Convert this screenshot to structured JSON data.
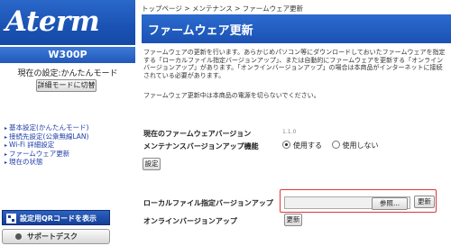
{
  "sidebar": {
    "logo": "Aterm",
    "model": "W300P",
    "mode_text": "現在の設定:かんたんモード",
    "mode_button": "詳細モードに切替",
    "nav_items": [
      {
        "label": "基本設定(かんたんモード)"
      },
      {
        "label": "接続先設定(公衆無線LAN)"
      },
      {
        "label": "Wi-Fi 詳細設定"
      },
      {
        "label": "ファームウェア更新"
      },
      {
        "label": "現在の状態"
      }
    ],
    "qr_button": "設定用QRコードを表示",
    "support_button": "サポートデスク"
  },
  "breadcrumb": "トップページ > メンテナンス > ファームウェア更新",
  "page_title": "ファームウェア更新",
  "description": "ファームウェアの更新を行います。あらかじめパソコン等にダウンロードしておいたファームウェアを指定する「ローカルファイル指定バージョンアップ」、または自動的にファームウェアを更新する「オンラインバージョンアップ」があります。「オンラインバージョンアップ」の場合は本商品がインターネットに接続されている必要があります。",
  "warning": "ファームウェア更新中は本商品の電源を切らないでください。",
  "firmware": {
    "version_label": "現在のファームウェアバージョン",
    "version_value": "1.1.0"
  },
  "maintenance": {
    "label": "メンテナンスバージョンアップ機能",
    "options": [
      "使用する",
      "使用しない"
    ],
    "selected": "使用する"
  },
  "set_button": "設定",
  "local_upgrade": {
    "label": "ローカルファイル指定バージョンアップ",
    "browse_button": "参照...",
    "update_button": "更新"
  },
  "online_upgrade": {
    "label": "オンラインバージョンアップ",
    "update_button": "更新"
  },
  "colors": {
    "brand_blue": "#1a52b3",
    "highlight_red": "#e23636",
    "link_blue": "#1f3fa8"
  }
}
